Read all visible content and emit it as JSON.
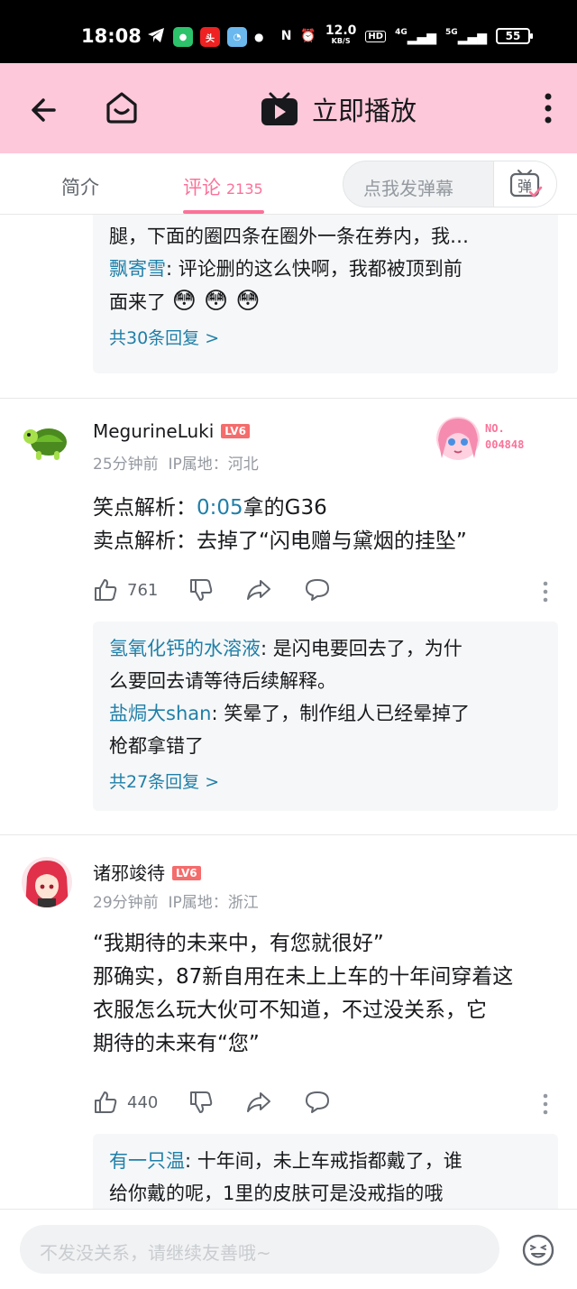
{
  "status_bar": {
    "time": "18:08",
    "speed_value": "12.0",
    "speed_unit": "KB/S",
    "hd": "HD",
    "net1": "4G",
    "net2": "5G",
    "battery": "55"
  },
  "header": {
    "title": "立即播放"
  },
  "tabs": {
    "intro": "简介",
    "comments": "评论",
    "comments_count": "2135",
    "danmaku_placeholder": "点我发弹幕",
    "danmaku_btn": "弹"
  },
  "prev_replies": {
    "line1": "腿，下面的圈四条在圈外一条在券内，我…",
    "reply_user": "飘寄雪",
    "reply_text_1": ": 评论删的这么快啊，我都被顶到前",
    "reply_text_2": "面来了",
    "emoji": "😳 😳 😳",
    "more": "共30条回复 >"
  },
  "comments": [
    {
      "user": "MegurineLuki",
      "level": "LV6",
      "time": "25分钟前",
      "ip": "IP属地：河北",
      "fan_no_label": "NO.",
      "fan_no": "004848",
      "line1_prefix": "笑点解析：",
      "line1_timestamp": "0:05",
      "line1_suffix": "拿的G36",
      "line2": "卖点解析：去掉了“闪电赠与黛烟的挂坠”",
      "likes": "761",
      "replies": [
        {
          "user": "氢氧化钙的水溶液",
          "text": ": 是闪电要回去了，为什",
          "text2": "么要回去请等待后续解释。"
        },
        {
          "user": "盐焗大shan",
          "text": ": 笑晕了，制作组人已经晕掉了",
          "text2": "枪都拿错了"
        }
      ],
      "more": "共27条回复 >"
    },
    {
      "user": "诸邪竣待",
      "level": "LV6",
      "time": "29分钟前",
      "ip": "IP属地：浙江",
      "lines": [
        "“我期待的未来中，有您就很好”",
        "那确实，87新自用在未上上车的十年间穿着这",
        "衣服怎么玩大伙可不知道，不过没关系，它",
        "期待的未来有“您”"
      ],
      "likes": "440",
      "reply_user": "有一只温",
      "reply_text_1": ": 十年间，未上车戒指都戴了，谁",
      "reply_text_2": "给你戴的呢，1里的皮肤可是没戒指的哦"
    }
  ],
  "bottom": {
    "placeholder": "不发没关系，请继续友善哦~"
  },
  "colors": {
    "header_bg": "#fdc8d9",
    "accent": "#fb7299",
    "link": "#1f7fa8"
  }
}
